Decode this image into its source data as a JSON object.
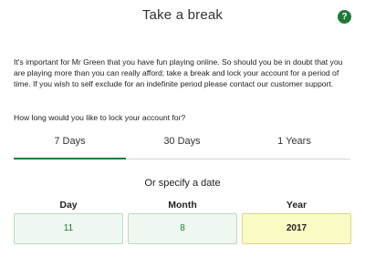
{
  "header": {
    "title": "Take a break",
    "help_icon": "question-icon",
    "help_glyph": "?"
  },
  "intro": "It's important for Mr Green that you have fun playing online. So should you be in doubt that you are playing more than you can really afford; take a break and lock your account for a period of time. If you wish to self exclude for an indefinite period please contact our customer support.",
  "question": "How long would you like to lock your account for?",
  "tabs": [
    {
      "label": "7 Days",
      "active": true
    },
    {
      "label": "30 Days",
      "active": false
    },
    {
      "label": "1 Years",
      "active": false
    }
  ],
  "or_specify": "Or specify a date",
  "date": {
    "day_label": "Day",
    "day_value": "11",
    "month_label": "Month",
    "month_value": "8",
    "year_label": "Year",
    "year_value": "2017"
  },
  "colors": {
    "accent": "#1f7a3a",
    "field_bg": "#eef7f0",
    "year_bg": "#fbfbc4"
  }
}
